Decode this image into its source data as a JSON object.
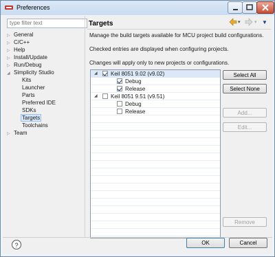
{
  "window": {
    "title": "Preferences"
  },
  "filter": {
    "placeholder": "type filter text"
  },
  "nav_tree": [
    {
      "label": "General",
      "expandable": true
    },
    {
      "label": "C/C++",
      "expandable": true
    },
    {
      "label": "Help",
      "expandable": true
    },
    {
      "label": "Install/Update",
      "expandable": true
    },
    {
      "label": "Run/Debug",
      "expandable": true
    },
    {
      "label": "Simplicity Studio",
      "expandable": true,
      "expanded": true
    },
    {
      "label": "Kits",
      "child": true
    },
    {
      "label": "Launcher",
      "child": true
    },
    {
      "label": "Parts",
      "child": true
    },
    {
      "label": "Preferred IDE",
      "child": true
    },
    {
      "label": "SDKs",
      "child": true
    },
    {
      "label": "Targets",
      "child": true,
      "selected": true
    },
    {
      "label": "Toolchains",
      "child": true
    },
    {
      "label": "Team",
      "expandable": true
    }
  ],
  "page": {
    "title": "Targets",
    "desc1": "Manage the build targets available for MCU project build configurations.",
    "desc2": "Checked entries are displayed when configuring projects.",
    "desc3": "Changes will apply only to new projects or configurations."
  },
  "targets": [
    {
      "label": "Keil 8051 9.02 (v9.02)",
      "checked": true,
      "level": 0,
      "highlight": true
    },
    {
      "label": "Debug",
      "checked": true,
      "level": 1
    },
    {
      "label": "Release",
      "checked": true,
      "level": 1
    },
    {
      "label": "Keil 8051 9.51 (v9.51)",
      "checked": false,
      "level": 0
    },
    {
      "label": "Debug",
      "checked": false,
      "level": 1
    },
    {
      "label": "Release",
      "checked": false,
      "level": 1
    }
  ],
  "buttons": {
    "select_all": "Select All",
    "select_none": "Select None",
    "add": "Add...",
    "edit": "Edit...",
    "remove": "Remove",
    "ok": "OK",
    "cancel": "Cancel"
  },
  "help": {
    "label": "?"
  },
  "icons": {
    "back": "back-arrow-icon",
    "forward": "forward-arrow-icon",
    "menu": "view-menu-icon"
  },
  "colors": {
    "selection": "#d6e7fb",
    "accent": "#3c7fb1",
    "nav_arrow": "#d4a017"
  }
}
